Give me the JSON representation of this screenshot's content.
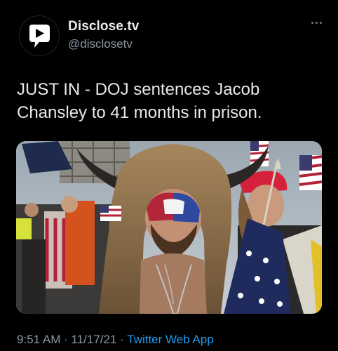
{
  "account": {
    "display_name": "Disclose.tv",
    "handle": "@disclosetv",
    "avatar_icon": "disclose-tv-logo-icon"
  },
  "menu": {
    "more_icon": "more-horizontal-icon"
  },
  "tweet": {
    "text_line1": "JUST IN - DOJ sentences Jacob",
    "text_line2": "Chansley to 41 months in prison."
  },
  "media": {
    "type": "photo"
  },
  "meta": {
    "time": "9:51 AM",
    "separator1": " · ",
    "date": "11/17/21",
    "separator2": " · ",
    "source": "Twitter Web App"
  },
  "colors": {
    "background": "#000000",
    "text": "#e7e9ea",
    "secondary_text": "#8b98a5",
    "link": "#1d9bf0"
  }
}
